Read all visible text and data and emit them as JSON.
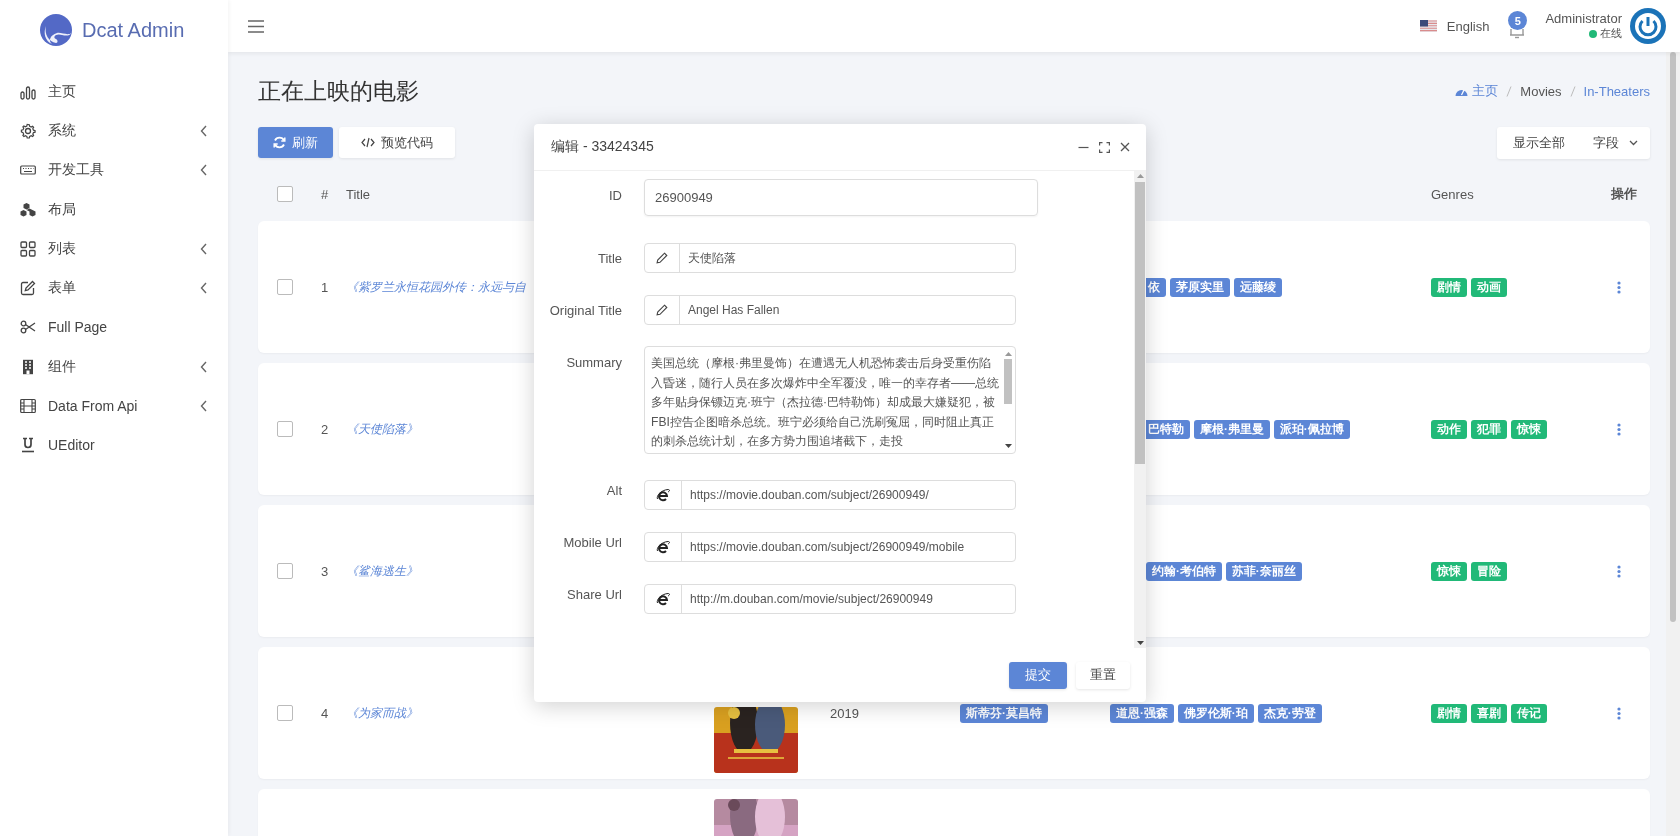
{
  "brand": {
    "name": "Dcat Admin"
  },
  "sidebar": {
    "items": [
      {
        "label": "主页",
        "expandable": false
      },
      {
        "label": "系统",
        "expandable": true
      },
      {
        "label": "开发工具",
        "expandable": true
      },
      {
        "label": "布局",
        "expandable": false
      },
      {
        "label": "列表",
        "expandable": true
      },
      {
        "label": "表单",
        "expandable": true
      },
      {
        "label": "Full Page",
        "expandable": false
      },
      {
        "label": "组件",
        "expandable": true
      },
      {
        "label": "Data From Api",
        "expandable": true
      },
      {
        "label": "UEditor",
        "expandable": false
      }
    ]
  },
  "topbar": {
    "language": "English",
    "notifications": "5",
    "user": {
      "name": "Administrator",
      "status": "在线"
    }
  },
  "page": {
    "title": "正在上映的电影",
    "breadcrumb": [
      {
        "label": "主页",
        "kind": "home"
      },
      {
        "label": "Movies",
        "kind": "plain"
      },
      {
        "label": "In-Theaters",
        "kind": "link"
      }
    ]
  },
  "toolbar": {
    "buttons": [
      {
        "label": "刷新",
        "kind": "primary"
      },
      {
        "label": "预览代码",
        "kind": "default"
      }
    ],
    "right": [
      "显示全部",
      "字段"
    ]
  },
  "table": {
    "header_checked": false,
    "columns": [
      "#",
      "Title",
      "Genres",
      "操作"
    ],
    "rows": [
      {
        "checked": false,
        "index": "1",
        "title": "《紫罗兰永恒花园外传：永远与自",
        "cast_cut": true,
        "cast": [
          "依",
          "茅原实里",
          "远藤绫"
        ],
        "genres": [
          "剧情",
          "动画"
        ]
      },
      {
        "checked": false,
        "index": "2",
        "title": "《天使陷落》",
        "cast_cut": true,
        "cast": [
          "巴特勒",
          "摩根·弗里曼",
          "派珀·佩拉博"
        ],
        "genres": [
          "动作",
          "犯罪",
          "惊悚"
        ]
      },
      {
        "checked": false,
        "index": "3",
        "title": "《鲨海逃生》",
        "cast_cut": false,
        "cast": [
          "约翰·考伯特",
          "苏菲·奈丽丝"
        ],
        "genres": [
          "惊悚",
          "冒险"
        ]
      },
      {
        "checked": false,
        "index": "4",
        "title": "《为家而战》",
        "poster": {
          "kind": "picture"
        },
        "year": "2019",
        "director": [
          "斯蒂芬·莫昌特"
        ],
        "cast_cut": false,
        "cast": [
          "道恩·强森",
          "佛罗伦斯·珀",
          "杰克·劳登"
        ],
        "genres": [
          "剧情",
          "喜剧",
          "传记"
        ]
      },
      {
        "poster": {
          "kind": "picture"
        }
      }
    ]
  },
  "modal": {
    "title": "编辑 - 33424345",
    "fields": [
      {
        "label": "ID",
        "kind": "text",
        "value": "26900949"
      },
      {
        "label": "Title",
        "kind": "pencil",
        "value": "天使陷落"
      },
      {
        "label": "Original Title",
        "kind": "pencil",
        "value": "Angel Has Fallen"
      },
      {
        "label": "Summary",
        "kind": "textarea",
        "value": "美国总统（摩根·弗里曼饰）在遭遇无人机恐怖袭击后身受重伤陷入昏迷，随行人员在多次爆炸中全军覆没，唯一的幸存者——总统多年贴身保镖迈克·班宁（杰拉德·巴特勒饰）却成最大嫌疑犯，被FBI控告企图暗杀总统。班宁必须给自己洗刷冤屈，同时阻止真正的刺杀总统计划，在多方势力围追堵截下，走投"
      },
      {
        "label": "Alt",
        "kind": "url",
        "value": "https://movie.douban.com/subject/26900949/"
      },
      {
        "label": "Mobile Url",
        "kind": "url",
        "value": "https://movie.douban.com/subject/26900949/mobile"
      },
      {
        "label": "Share Url",
        "kind": "url",
        "value": "http://m.douban.com/movie/subject/26900949"
      }
    ],
    "buttons": [
      {
        "label": "提交",
        "kind": "primary"
      },
      {
        "label": "重置",
        "kind": "default"
      }
    ]
  }
}
